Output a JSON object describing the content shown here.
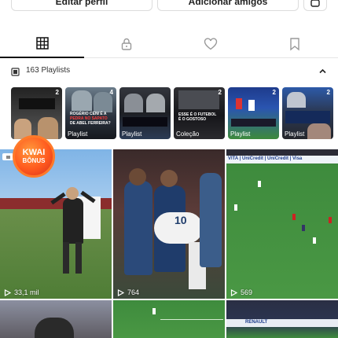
{
  "top_buttons": {
    "edit_label": "Editar perfil",
    "add_label": "Adicionar amigos"
  },
  "tabs": [
    {
      "icon": "grid-icon",
      "active": true
    },
    {
      "icon": "lock-icon",
      "active": false
    },
    {
      "icon": "heart-icon",
      "active": false
    },
    {
      "icon": "bookmark-icon",
      "active": false
    }
  ],
  "playlists_header": {
    "count_label": "163 Playlists"
  },
  "playlists": [
    {
      "label": "",
      "badge": "2",
      "caption": ""
    },
    {
      "label": "Playlist",
      "badge": "4",
      "caption_top": "ROGÉRIO CENI É A",
      "caption_red": "PEDRA NO SAPATO",
      "caption_bottom": "DE ABEL FERREIRA?"
    },
    {
      "label": "Playlist",
      "badge": "",
      "caption": ""
    },
    {
      "label": "Coleção",
      "badge": "2",
      "caption_top": "ESSE É O FUTEBOL",
      "caption_bottom": "É O GOSTOSO"
    },
    {
      "label": "Playlist",
      "badge": "2",
      "caption": ""
    },
    {
      "label": "Playlist",
      "badge": "2",
      "caption": ""
    }
  ],
  "kwai_badge": {
    "line1": "KWAI",
    "line2": "BÔNUS"
  },
  "grid_views": [
    "33,1 mil",
    "764",
    "569"
  ],
  "colors": {
    "accent": "#111111",
    "kwai": "#ff5a1f",
    "pitch": "#3f8a3a"
  }
}
